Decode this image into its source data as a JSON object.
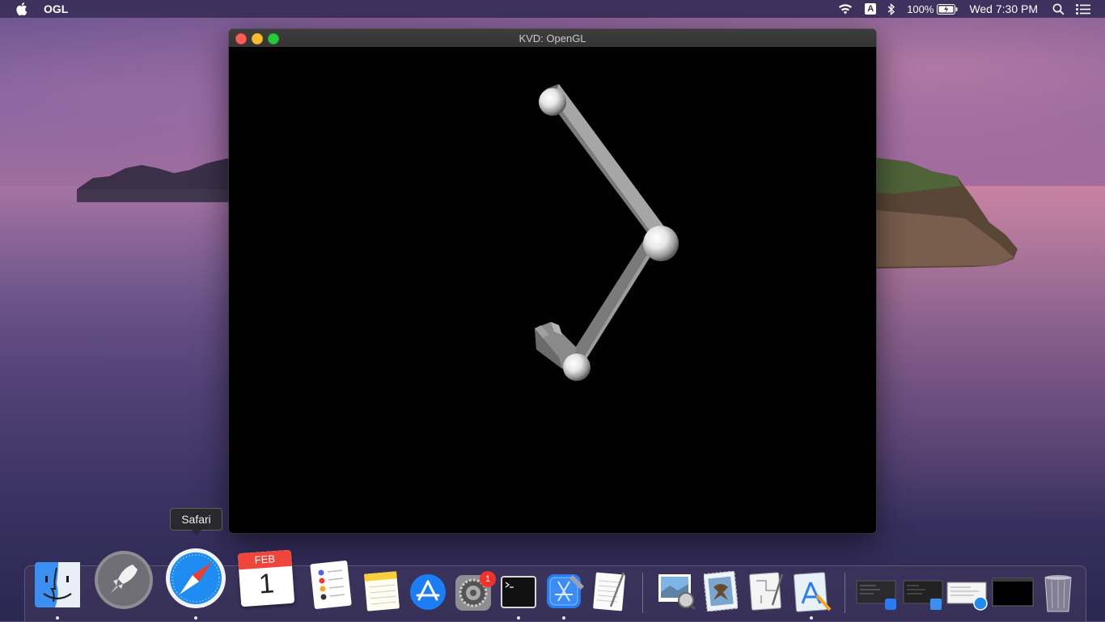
{
  "menubar": {
    "app_name": "OGL",
    "battery": "100%",
    "input_source": "A",
    "clock": "Wed 7:30 PM"
  },
  "window": {
    "title": "KVD: OpenGL"
  },
  "tooltip": {
    "label": "Safari"
  },
  "dock": {
    "calendar_month": "FEB",
    "calendar_day": "1",
    "system_prefs_badge": "1",
    "items": [
      "Finder",
      "Launchpad",
      "Safari",
      "Calendar",
      "Reminders",
      "Notes",
      "App Store",
      "System Preferences",
      "Terminal",
      "Xcode",
      "TextEdit",
      "Preview",
      "Mail",
      "Script Editor",
      "Instruments"
    ]
  },
  "colors": {
    "accent_close": "#fe5f57",
    "accent_minimize": "#febc2e",
    "accent_zoom": "#28c840",
    "badge": "#f2322b"
  }
}
